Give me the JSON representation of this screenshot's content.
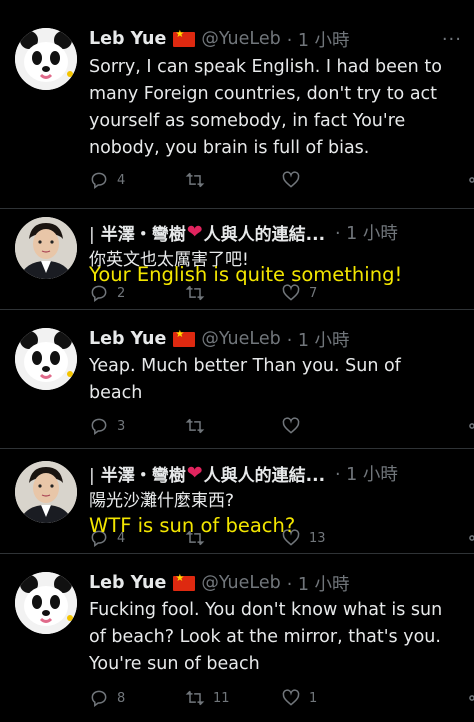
{
  "tweets": [
    {
      "author": "Leb Yue",
      "handle": "@YueLeb",
      "time": "· 1 小時",
      "text_lines": [
        "Sorry, I can speak English. I had been to",
        "many Foreign countries, don't try to act",
        "yourself as somebody, in fact You're",
        "nobody, you brain is full of bias."
      ],
      "replies": "4",
      "retweets": "",
      "likes": ""
    },
    {
      "author": "半澤・彎樹",
      "author_suffix": "人與人的連結...",
      "time": "· 1 小時",
      "text": "你英文也太厲害了吧!",
      "caption": "Your English is quite something!",
      "replies": "2",
      "retweets": "",
      "likes": "7"
    },
    {
      "author": "Leb Yue",
      "handle": "@YueLeb",
      "time": "· 1 小時",
      "text_lines": [
        "Yeap. Much better Than you. Sun of",
        "beach"
      ],
      "replies": "3",
      "retweets": "",
      "likes": ""
    },
    {
      "author": "半澤・彎樹",
      "author_suffix": "人與人的連結...",
      "time": "· 1 小時",
      "text": "陽光沙灘什麼東西?",
      "caption": "WTF is sun of beach?",
      "replies": "4",
      "retweets": "",
      "likes": "13"
    },
    {
      "author": "Leb Yue",
      "handle": "@YueLeb",
      "time": "· 1 小時",
      "text_lines": [
        "Fucking fool. You don't know what is sun",
        "of beach? Look at the mirror, that's you.",
        "You're sun of beach"
      ],
      "replies": "8",
      "retweets": "11",
      "likes": "1"
    }
  ],
  "ui": {
    "more_glyph": "···",
    "separator_glyph": "|"
  },
  "colors": {
    "background": "#000000",
    "text": "#e7e9ea",
    "muted": "#71767b",
    "caption": "#f3e600",
    "heart": "#e0245e",
    "flag": "#de2910"
  },
  "icons": [
    "reply-icon",
    "retweet-icon",
    "like-icon",
    "share-icon",
    "more-icon",
    "china-flag-icon",
    "red-heart-emoji"
  ]
}
